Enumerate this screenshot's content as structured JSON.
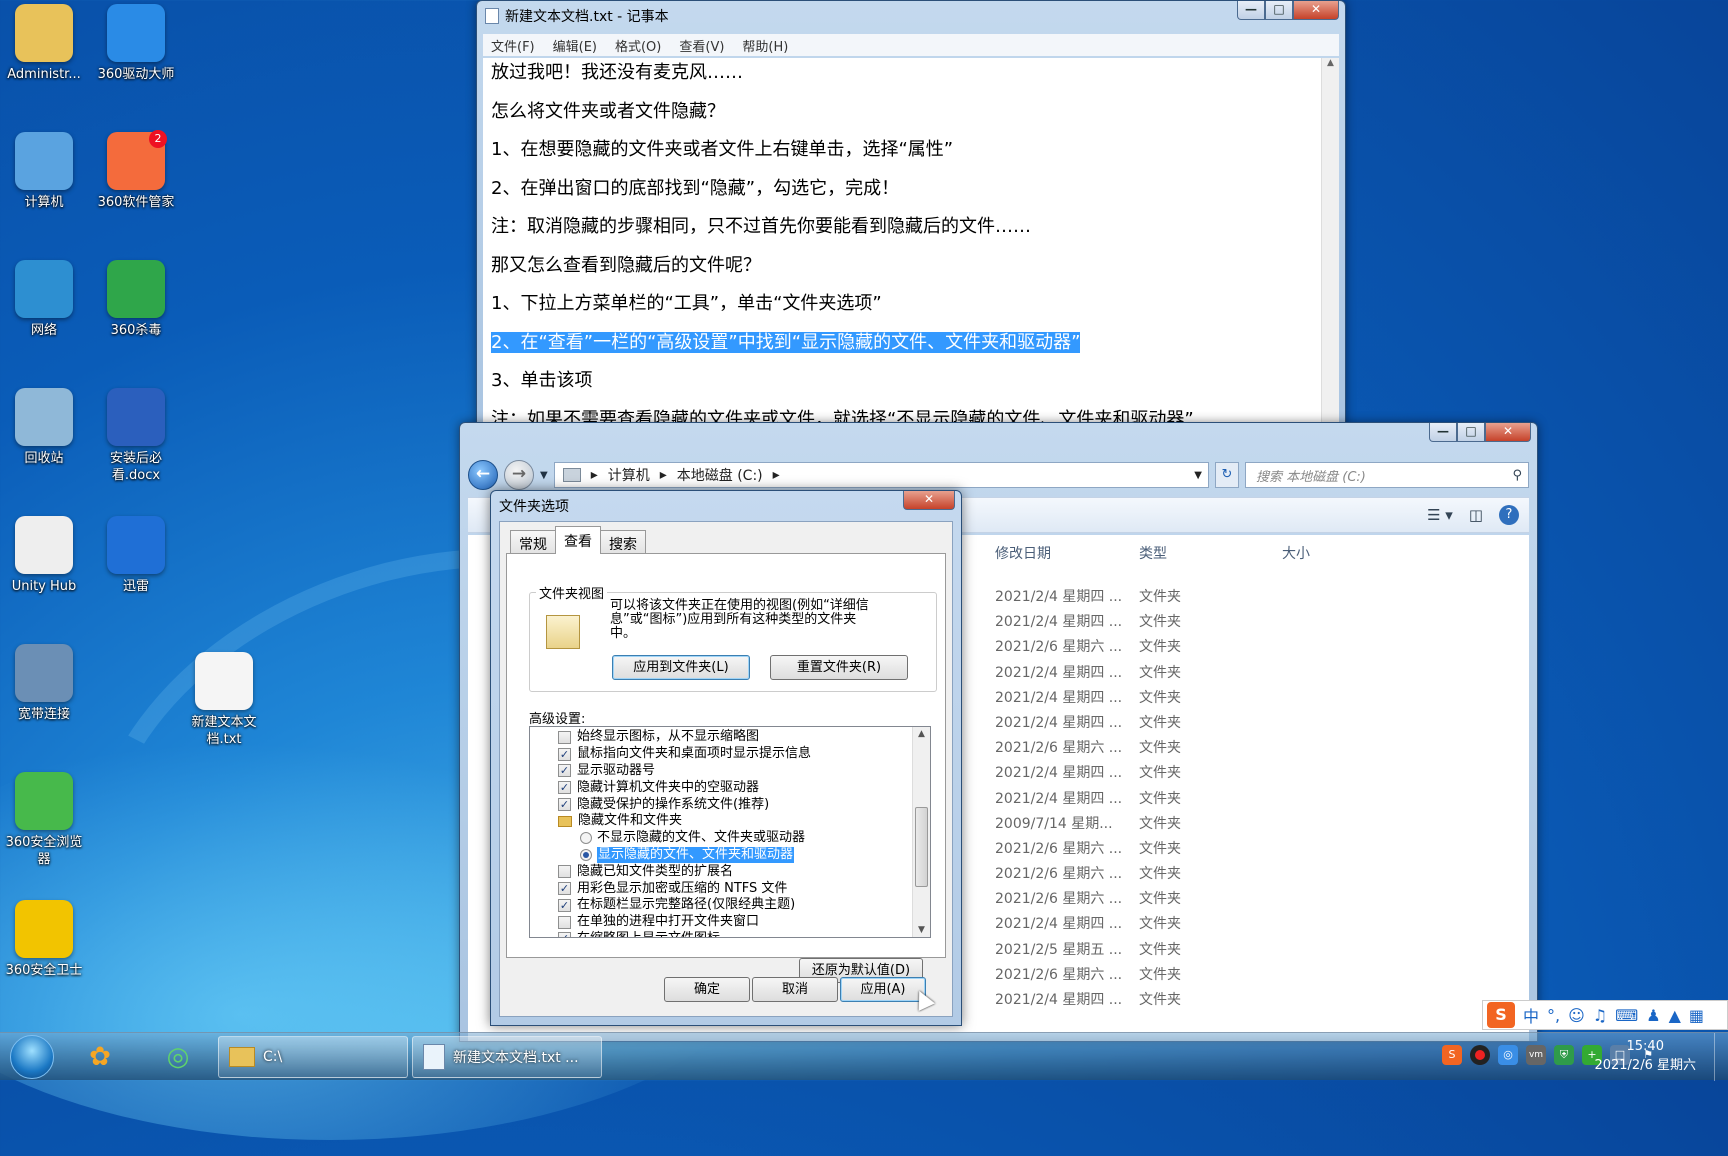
{
  "desktop": {
    "icons": [
      {
        "label": "Administr...",
        "icon": "user-folder-icon"
      },
      {
        "label": "360驱动大师",
        "icon": "driver-gear-icon"
      },
      {
        "label": "计算机",
        "icon": "computer-icon"
      },
      {
        "label": "360软件管家",
        "icon": "software-manager-icon",
        "badge": "2"
      },
      {
        "label": "网络",
        "icon": "network-globe-icon"
      },
      {
        "label": "360杀毒",
        "icon": "antivirus-shield-icon"
      },
      {
        "label": "回收站",
        "icon": "recycle-bin-icon"
      },
      {
        "label": "安装后必看.docx",
        "icon": "word-document-icon"
      },
      {
        "label": "Unity Hub",
        "icon": "unity-icon"
      },
      {
        "label": "迅雷",
        "icon": "thunder-bird-icon"
      },
      {
        "label": "宽带连接",
        "icon": "broadband-icon"
      },
      {
        "label": "新建文本文档.txt",
        "icon": "text-file-icon"
      },
      {
        "label": "360安全浏览器",
        "icon": "browser-e-icon"
      },
      {
        "label": "360安全卫士",
        "icon": "security-guard-icon"
      }
    ]
  },
  "notepad": {
    "title": "新建文本文档.txt - 记事本",
    "menu": [
      "文件(F)",
      "编辑(E)",
      "格式(O)",
      "查看(V)",
      "帮助(H)"
    ],
    "lines": [
      "放过我吧！我还没有麦克风……",
      "怎么将文件夹或者文件隐藏？",
      "1、在想要隐藏的文件夹或者文件上右键单击，选择“属性”",
      "2、在弹出窗口的底部找到“隐藏”，勾选它，完成！",
      "注：取消隐藏的步骤相同，只不过首先你要能看到隐藏后的文件……",
      "那又怎么查看到隐藏后的文件呢？",
      "1、下拉上方菜单栏的“工具”，单击“文件夹选项”",
      "2、在“查看”一栏的“高级设置”中找到“显示隐藏的文件、文件夹和驱动器”",
      "3、单击该项",
      "注：如果不需要查看隐藏的文件夹或文件，就选择“不显示隐藏的文件、文件夹和驱动器”"
    ],
    "selected_line_index": 7
  },
  "explorer": {
    "breadcrumb": [
      "计算机",
      "本地磁盘 (C:)"
    ],
    "search_placeholder": "搜索 本地磁盘 (C:)",
    "columns": [
      "修改日期",
      "类型",
      "大小"
    ],
    "rows": [
      {
        "date": "2021/2/4 星期四 ...",
        "type": "文件夹"
      },
      {
        "date": "2021/2/4 星期四 ...",
        "type": "文件夹"
      },
      {
        "date": "2021/2/6 星期六 ...",
        "type": "文件夹"
      },
      {
        "date": "2021/2/4 星期四 ...",
        "type": "文件夹"
      },
      {
        "date": "2021/2/4 星期四 ...",
        "type": "文件夹"
      },
      {
        "date": "2021/2/4 星期四 ...",
        "type": "文件夹"
      },
      {
        "date": "2021/2/6 星期六 ...",
        "type": "文件夹"
      },
      {
        "date": "2021/2/4 星期四 ...",
        "type": "文件夹"
      },
      {
        "date": "2021/2/4 星期四 ...",
        "type": "文件夹"
      },
      {
        "date": "2009/7/14 星期...",
        "type": "文件夹"
      },
      {
        "date": "2021/2/6 星期六 ...",
        "type": "文件夹"
      },
      {
        "date": "2021/2/6 星期六 ...",
        "type": "文件夹"
      },
      {
        "date": "2021/2/6 星期六 ...",
        "type": "文件夹"
      },
      {
        "date": "2021/2/4 星期四 ...",
        "type": "文件夹"
      },
      {
        "date": "2021/2/5 星期五 ...",
        "type": "文件夹"
      },
      {
        "date": "2021/2/6 星期六 ...",
        "type": "文件夹"
      },
      {
        "date": "2021/2/4 星期四 ...",
        "type": "文件夹"
      }
    ]
  },
  "dialog": {
    "title": "文件夹选项",
    "tabs": [
      "常规",
      "查看",
      "搜索"
    ],
    "active_tab": "查看",
    "folder_view_group": "文件夹视图",
    "folder_view_desc": "可以将该文件夹正在使用的视图(例如“详细信息”或“图标”)应用到所有这种类型的文件夹中。",
    "apply_to_folders": "应用到文件夹(L)",
    "reset_folders": "重置文件夹(R)",
    "advanced_label": "高级设置:",
    "advanced_items": [
      {
        "kind": "checkbox",
        "checked": false,
        "label": "始终显示图标，从不显示缩略图"
      },
      {
        "kind": "checkbox",
        "checked": true,
        "label": "鼠标指向文件夹和桌面项时显示提示信息"
      },
      {
        "kind": "checkbox",
        "checked": true,
        "label": "显示驱动器号"
      },
      {
        "kind": "checkbox",
        "checked": true,
        "label": "隐藏计算机文件夹中的空驱动器"
      },
      {
        "kind": "checkbox",
        "checked": true,
        "label": "隐藏受保护的操作系统文件(推荐)"
      },
      {
        "kind": "folder",
        "checked": false,
        "label": "隐藏文件和文件夹"
      },
      {
        "kind": "radio",
        "checked": false,
        "label": "不显示隐藏的文件、文件夹或驱动器"
      },
      {
        "kind": "radio",
        "checked": true,
        "label": "显示隐藏的文件、文件夹和驱动器",
        "highlighted": true
      },
      {
        "kind": "checkbox",
        "checked": false,
        "label": "隐藏已知文件类型的扩展名"
      },
      {
        "kind": "checkbox",
        "checked": true,
        "label": "用彩色显示加密或压缩的 NTFS 文件"
      },
      {
        "kind": "checkbox",
        "checked": true,
        "label": "在标题栏显示完整路径(仅限经典主题)"
      },
      {
        "kind": "checkbox",
        "checked": false,
        "label": "在单独的进程中打开文件夹窗口"
      },
      {
        "kind": "checkbox",
        "checked": true,
        "label": "在缩略图上显示文件图标"
      }
    ],
    "restore_defaults": "还原为默认值(D)",
    "ok": "确定",
    "cancel": "取消",
    "apply": "应用(A)"
  },
  "taskbar": {
    "tasks": [
      {
        "label": "C:\\",
        "icon": "explorer-folder-icon"
      },
      {
        "label": "新建文本文档.txt ...",
        "icon": "notepad-icon"
      }
    ],
    "time": "15:40",
    "date": "2021/2/6 星期六"
  },
  "ime": {
    "logo": "S",
    "mode": "中"
  },
  "colors": {
    "selection": "#3399ff",
    "desktop": "#0a5cb8"
  }
}
